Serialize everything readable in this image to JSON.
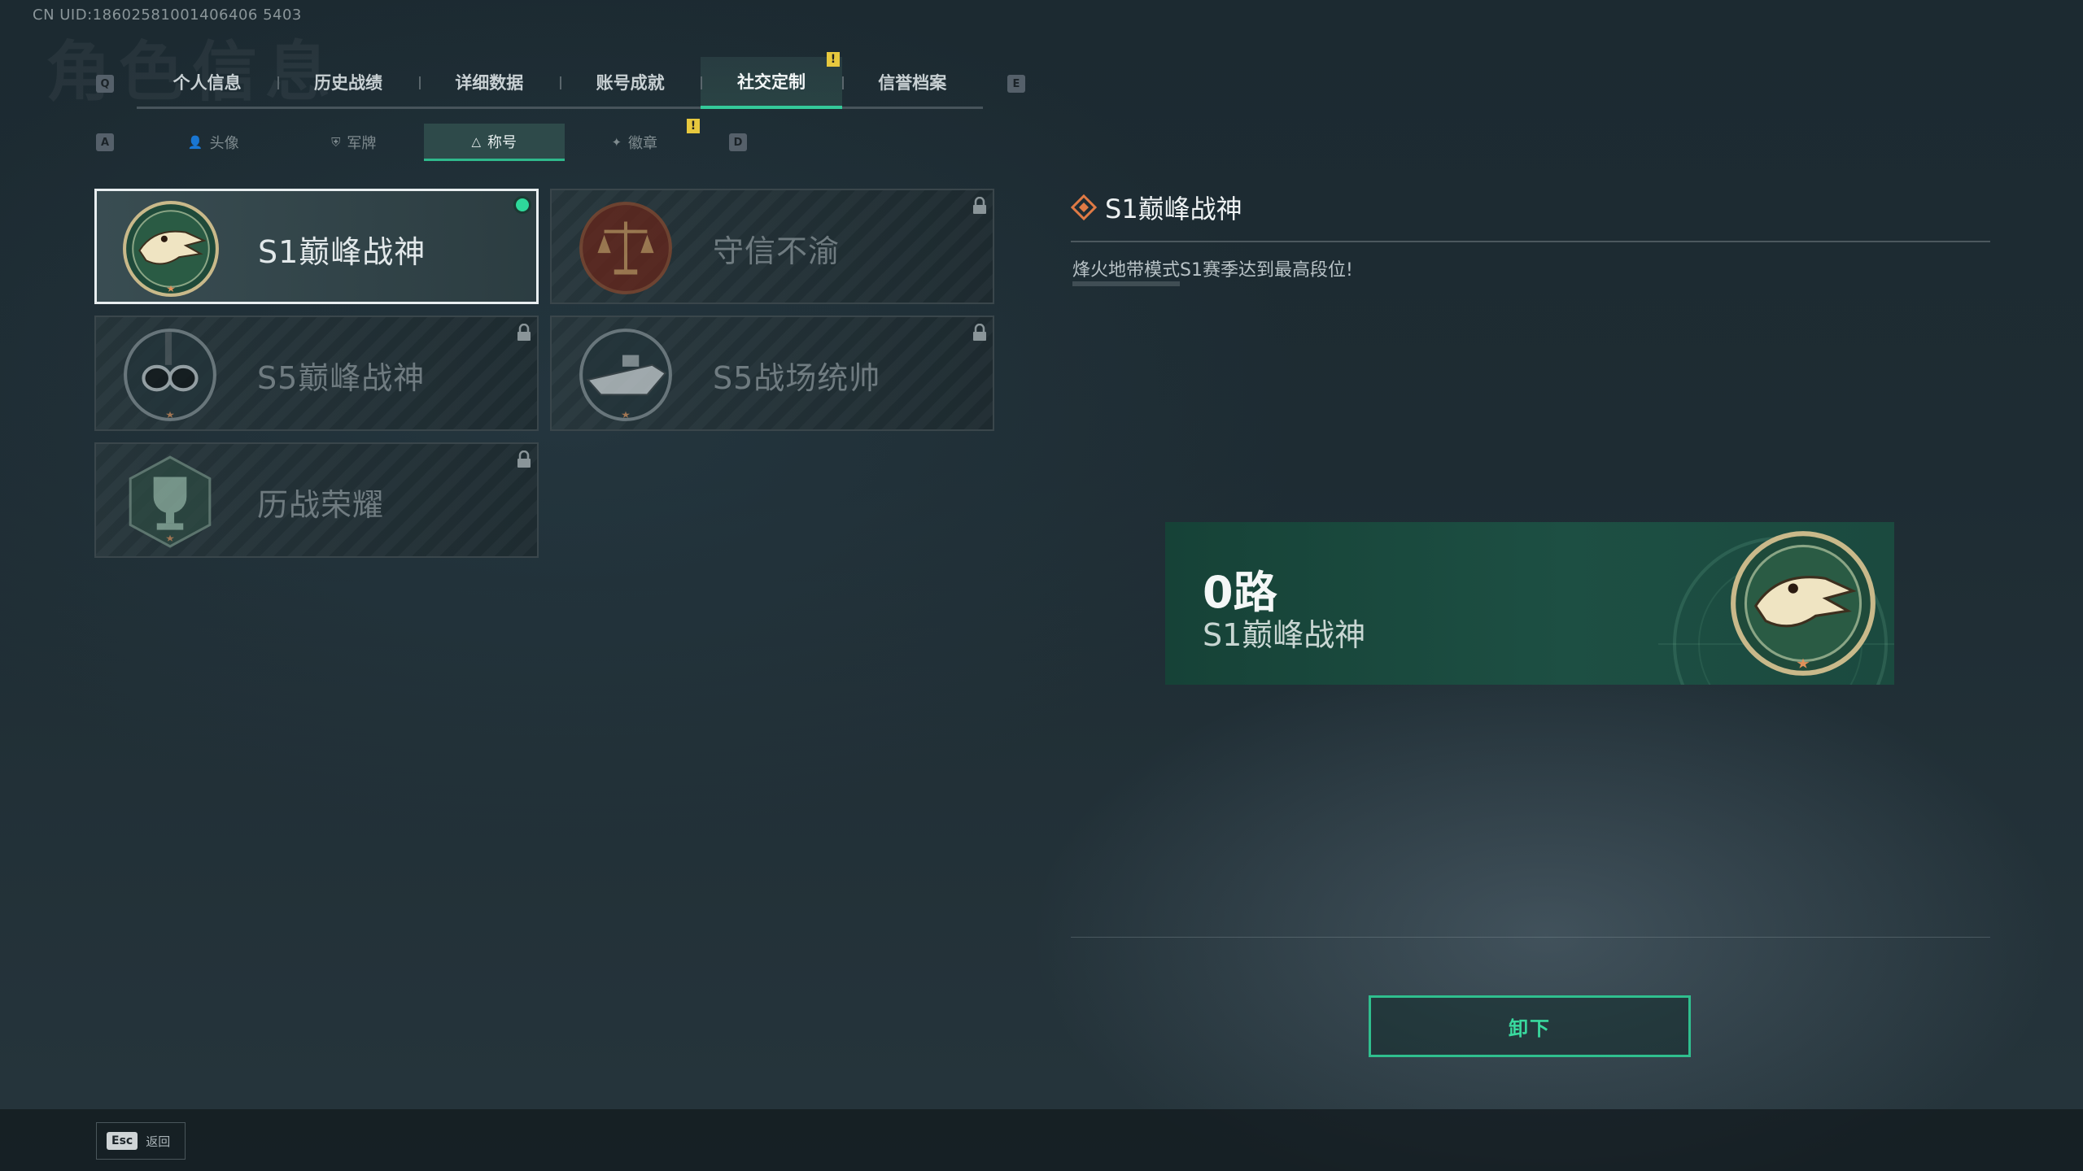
{
  "uid": "CN UID:18602581001406406 5403",
  "tabs": {
    "key_left": "Q",
    "key_right": "E",
    "alert": "!",
    "items": [
      {
        "label": "个人信息"
      },
      {
        "label": "历史战绩"
      },
      {
        "label": "详细数据"
      },
      {
        "label": "账号成就"
      },
      {
        "label": "社交定制",
        "active": true
      },
      {
        "label": "信誉档案"
      }
    ]
  },
  "subtabs": {
    "key_left": "A",
    "key_right": "D",
    "alert": "!",
    "items": [
      {
        "label": "头像",
        "icon": "person-icon"
      },
      {
        "label": "军牌",
        "icon": "dogtag-icon"
      },
      {
        "label": "称号",
        "icon": "title-icon",
        "active": true
      },
      {
        "label": "徽章",
        "icon": "badge-icon"
      }
    ]
  },
  "titles": [
    {
      "name": "S1巅峰战神",
      "emblem": "crocodile-icon",
      "selected": true,
      "equipped": true,
      "locked": false
    },
    {
      "name": "守信不渝",
      "emblem": "scales-icon",
      "selected": false,
      "locked": true
    },
    {
      "name": "S5巅峰战神",
      "emblem": "diver-mask-icon",
      "selected": false,
      "locked": true
    },
    {
      "name": "S5战场统帅",
      "emblem": "boat-icon",
      "selected": false,
      "locked": true
    },
    {
      "name": "历战荣耀",
      "emblem": "trophy-icon",
      "selected": false,
      "locked": true
    }
  ],
  "detail": {
    "title": "S1巅峰战神",
    "description": "烽火地带模式S1赛季达到最高段位!"
  },
  "preview": {
    "player_name": "0路",
    "title": "S1巅峰战神"
  },
  "unequip_button": "卸下",
  "footer": {
    "esc_key": "Esc",
    "esc_label": "返回"
  },
  "colors": {
    "accent": "#2fbf8e",
    "equipped_dot": "#2ed89a",
    "alert": "#e7c83e",
    "banner_bg": "#1d4f43"
  }
}
